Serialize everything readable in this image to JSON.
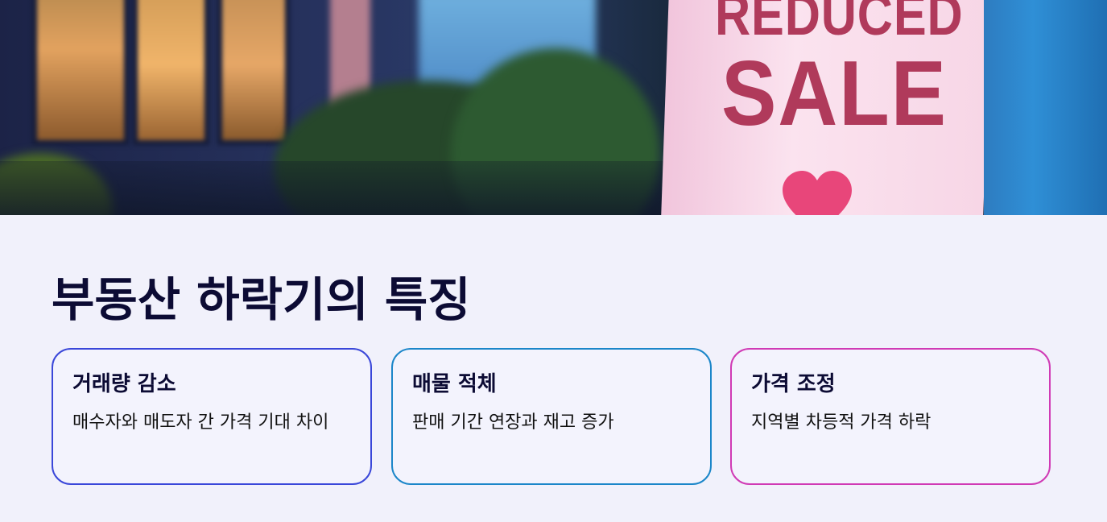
{
  "hero": {
    "sign_line1": "REDUCED",
    "sign_line2": "SALE"
  },
  "page_title": "부동산 하락기의 특징",
  "cards": [
    {
      "title": "거래량 감소",
      "description": "매수자와 매도자 간 가격 기대 차이",
      "border_color": "#3a47d9"
    },
    {
      "title": "매물 적체",
      "description": "판매 기간 연장과 재고 증가",
      "border_color": "#1b86c9"
    },
    {
      "title": "가격 조정",
      "description": "지역별 차등적 가격 하락",
      "border_color": "#d03ab5"
    }
  ],
  "colors": {
    "background": "#f1f1fb",
    "heading": "#0c0b34",
    "sign_text": "#b03a5b",
    "heart": "#e8467a"
  }
}
